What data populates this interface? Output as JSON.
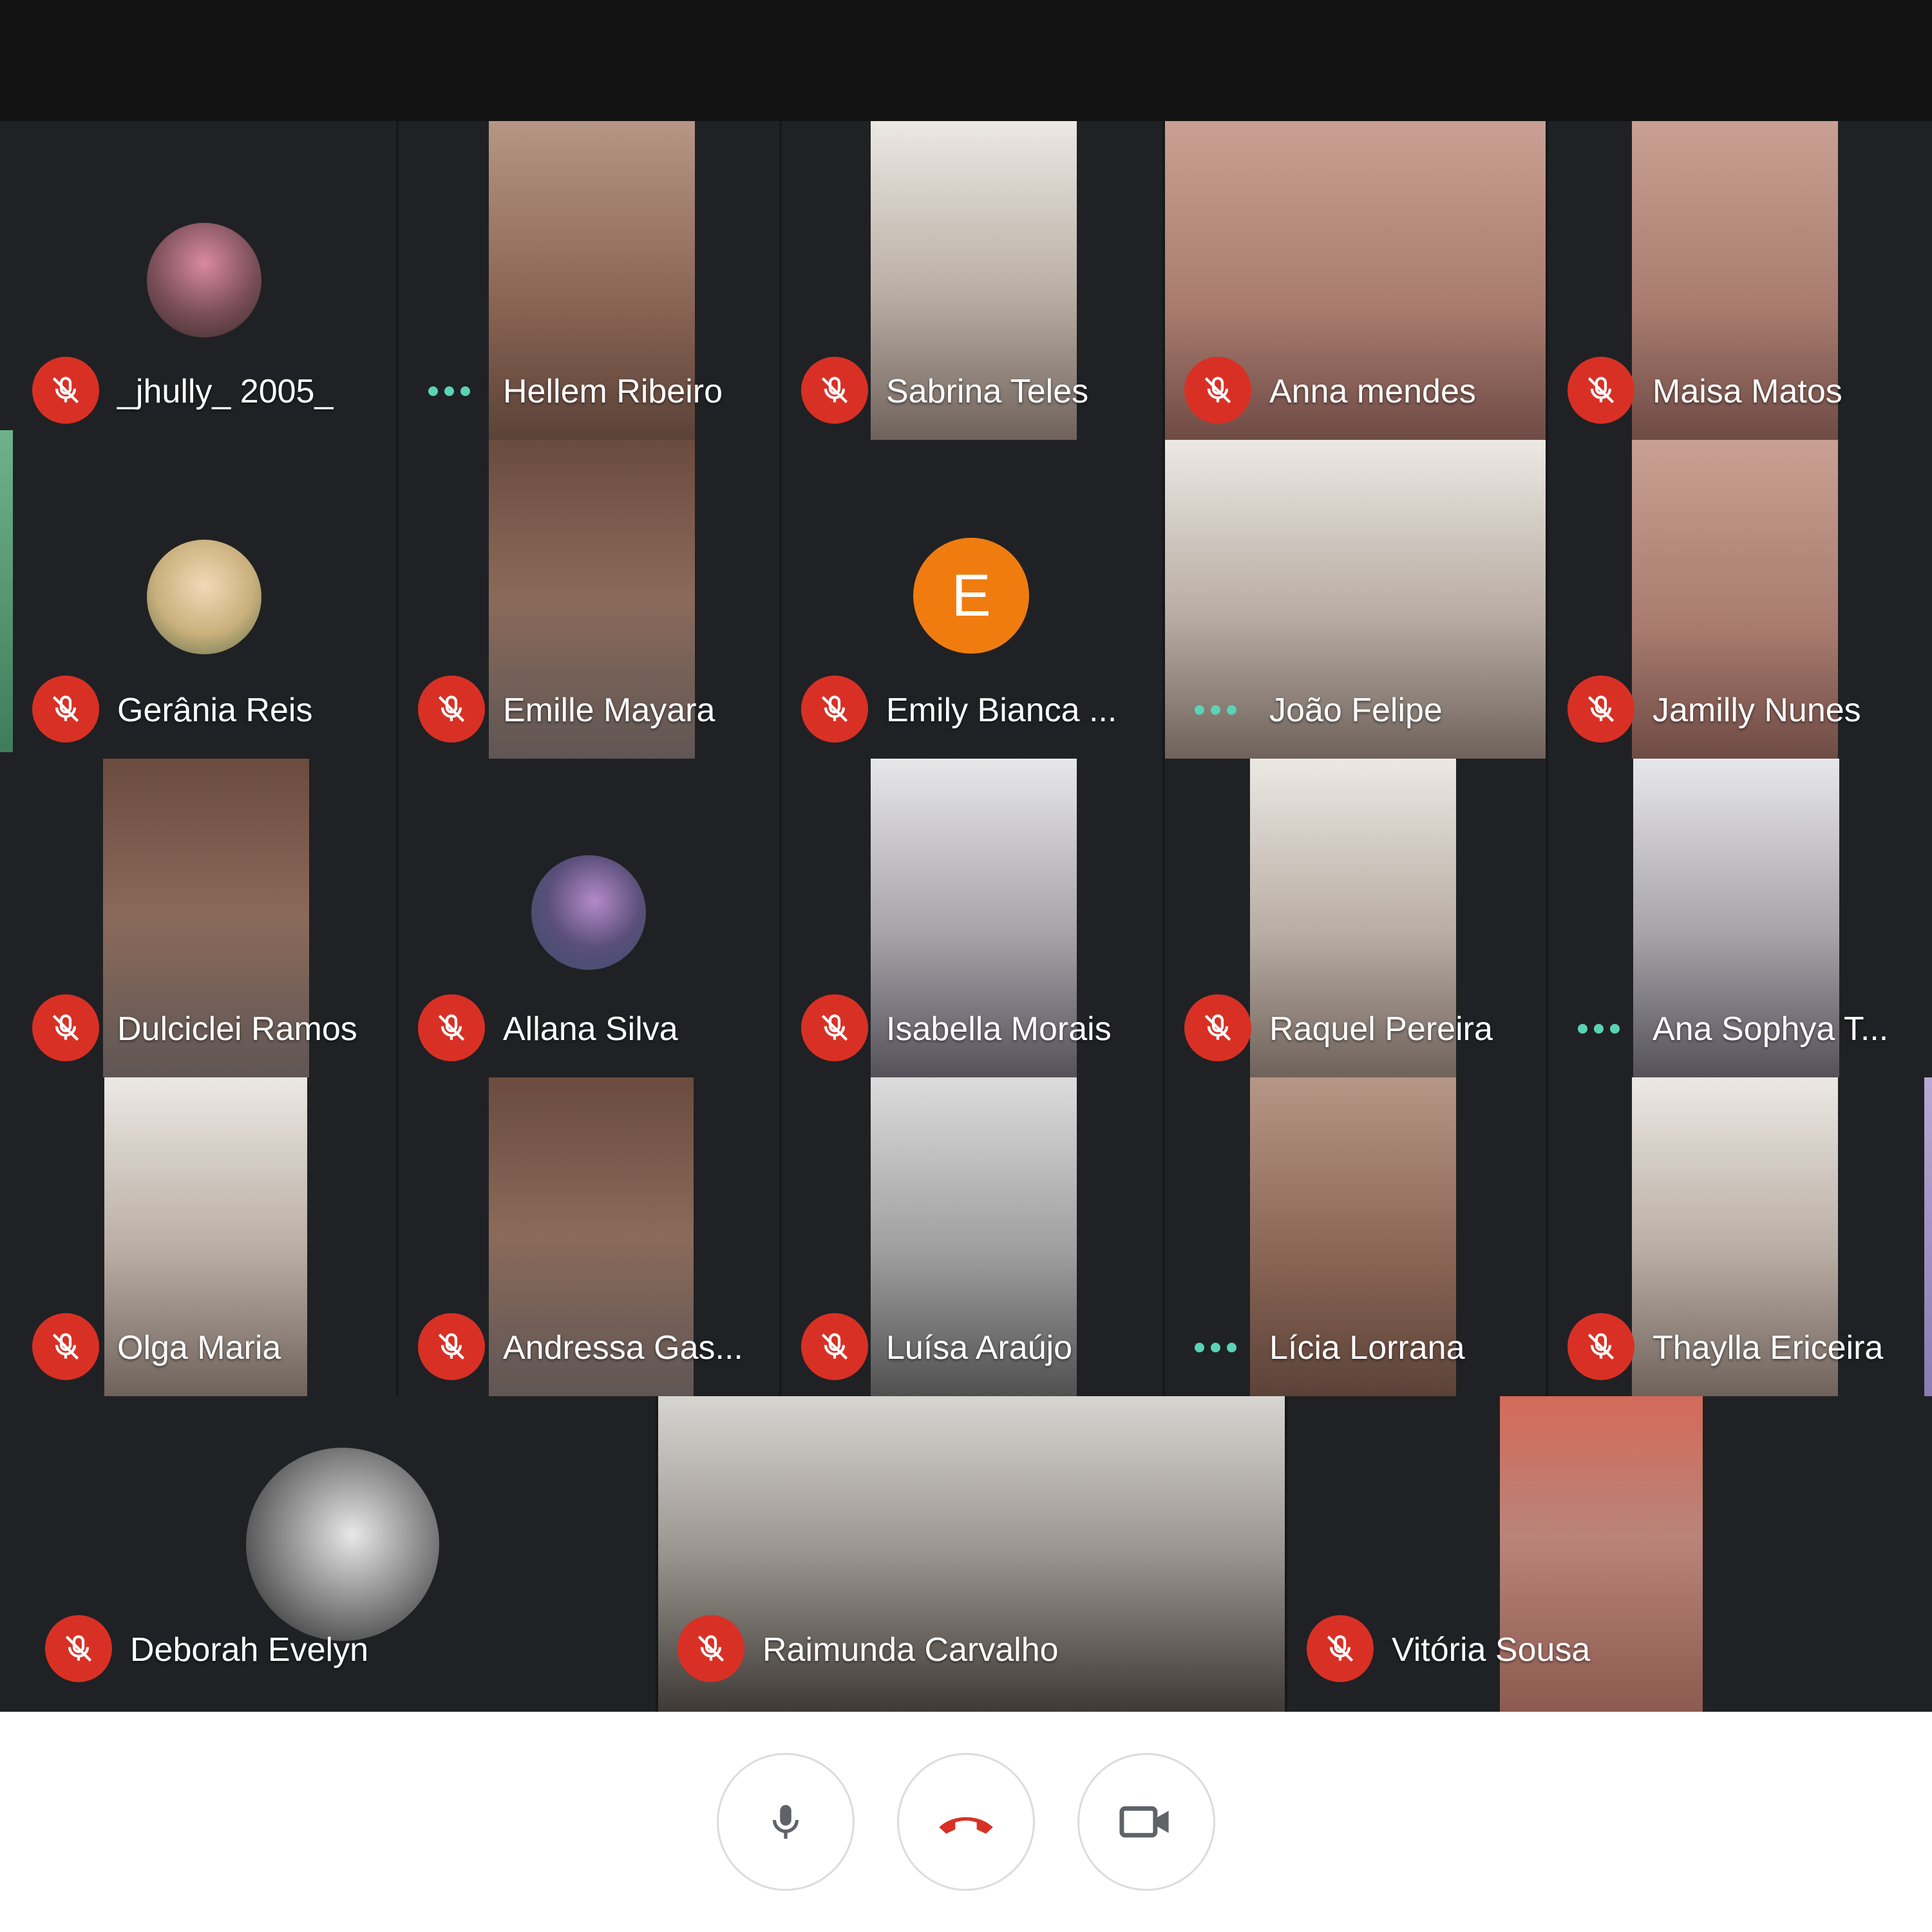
{
  "participants": [
    {
      "name": "_jhully_ 2005_",
      "status": "muted"
    },
    {
      "name": "Hellem Ribeiro",
      "status": "speaking"
    },
    {
      "name": "Sabrina Teles",
      "status": "muted"
    },
    {
      "name": "Anna mendes",
      "status": "muted"
    },
    {
      "name": "Maisa Matos",
      "status": "muted"
    },
    {
      "name": "Gerânia Reis",
      "status": "muted"
    },
    {
      "name": "Emille Mayara",
      "status": "muted"
    },
    {
      "name": "Emily Bianca ...",
      "status": "muted",
      "avatar_letter": "E"
    },
    {
      "name": "João Felipe",
      "status": "speaking"
    },
    {
      "name": "Jamilly Nunes",
      "status": "muted"
    },
    {
      "name": "Dulciclei Ramos",
      "status": "muted"
    },
    {
      "name": "Allana Silva",
      "status": "muted"
    },
    {
      "name": "Isabella Morais",
      "status": "muted"
    },
    {
      "name": "Raquel Pereira",
      "status": "muted"
    },
    {
      "name": "Ana Sophya T...",
      "status": "speaking"
    },
    {
      "name": "Olga Maria",
      "status": "muted"
    },
    {
      "name": "Andressa Gas...",
      "status": "muted"
    },
    {
      "name": "Luísa Araújo",
      "status": "muted"
    },
    {
      "name": "Lícia Lorrana",
      "status": "speaking"
    },
    {
      "name": "Thaylla Ericeira",
      "status": "muted"
    },
    {
      "name": "Deborah Evelyn",
      "status": "muted"
    },
    {
      "name": "Raimunda Carvalho",
      "status": "muted"
    },
    {
      "name": "Vitória Sousa",
      "status": "muted"
    }
  ],
  "controls": {
    "microphone": "mic-icon",
    "hangup": "hangup-icon",
    "camera": "camera-icon"
  },
  "colors": {
    "muted_badge": "#d93025",
    "speaking_dots": "#5ad3b4",
    "tile_background": "#202124",
    "avatar_orange": "#f07c10"
  }
}
